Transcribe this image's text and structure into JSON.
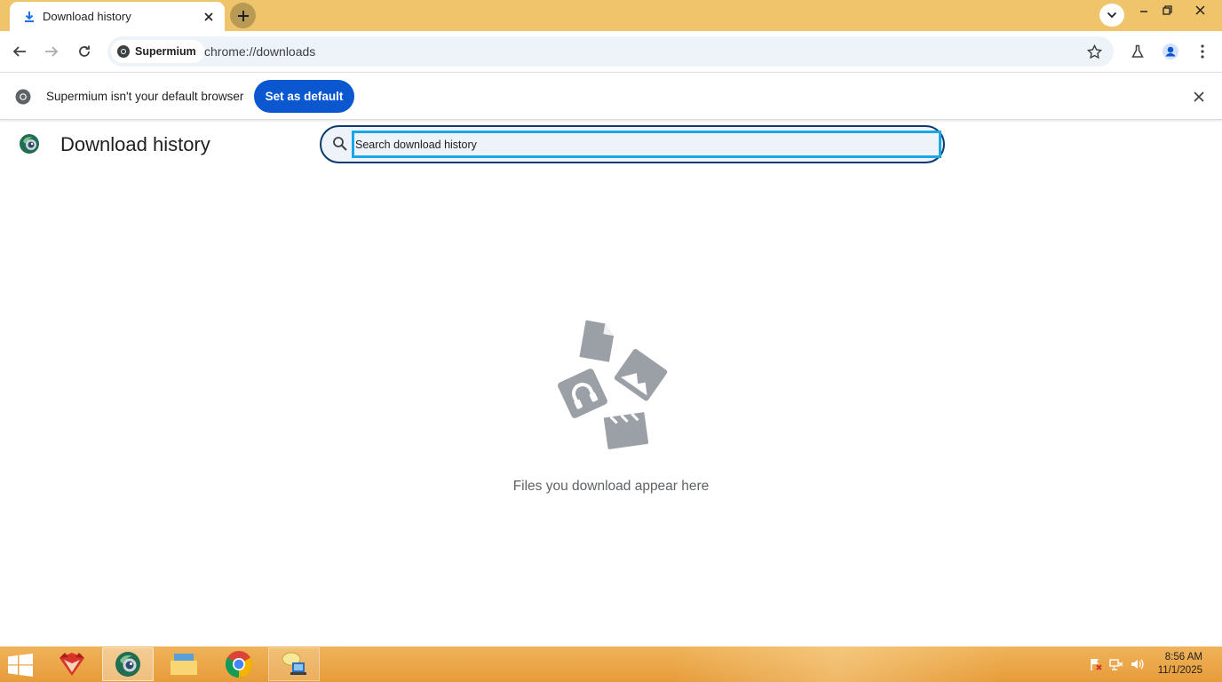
{
  "browser": {
    "tab": {
      "title": "Download history"
    },
    "omnibox": {
      "chip_label": "Supermium",
      "url": "chrome://downloads"
    }
  },
  "infobar": {
    "message": "Supermium isn't your default browser",
    "button_label": "Set as default"
  },
  "page": {
    "title": "Download history",
    "search_placeholder": "Search download history",
    "empty_message": "Files you download appear here"
  },
  "taskbar": {
    "clock": {
      "time": "8:56 AM",
      "date": "11/1/2025"
    }
  },
  "colors": {
    "tabstrip": "#f0c46a",
    "accent": "#0b57d0",
    "search_focus": "#1aa7e8",
    "taskbar": "#e9a340"
  }
}
